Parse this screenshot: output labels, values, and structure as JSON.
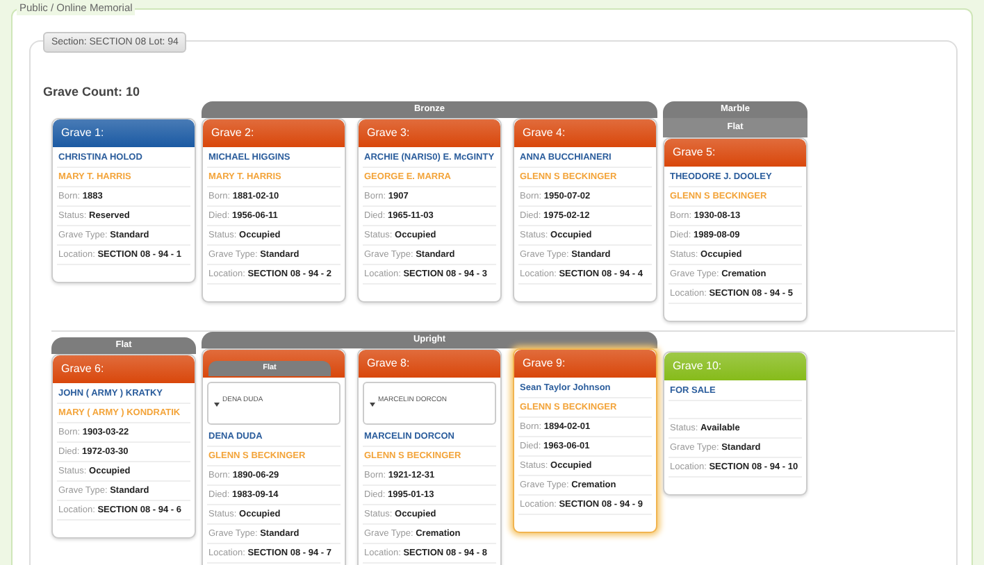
{
  "breadcrumb": "Public / Online Memorial",
  "section_legend": "Section: SECTION 08 Lot: 94",
  "grave_count": "Grave Count: 10",
  "rows": [
    {
      "groups": [
        {
          "graves": [
            {
              "title": "Grave 1:",
              "color": "#1b5aa3",
              "selected": false,
              "name": "CHRISTINA HOLOD",
              "owner": "MARY T. HARRIS",
              "fields": [
                {
                  "label": "Born:",
                  "value": "1883"
                },
                {
                  "label": "Status:",
                  "value": "Reserved"
                },
                {
                  "label": "Grave Type:",
                  "value": "Standard"
                },
                {
                  "label": "Location:",
                  "value": "SECTION 08 - 94 - 1"
                }
              ]
            }
          ]
        },
        {
          "labels": [
            "Bronze"
          ],
          "graves": [
            {
              "title": "Grave 2:",
              "color": "#d9470b",
              "selected": false,
              "name": "MICHAEL HIGGINS",
              "owner": "MARY T. HARRIS",
              "fields": [
                {
                  "label": "Born:",
                  "value": "1881-02-10"
                },
                {
                  "label": "Died:",
                  "value": "1956-06-11"
                },
                {
                  "label": "Status:",
                  "value": "Occupied"
                },
                {
                  "label": "Grave Type:",
                  "value": "Standard"
                },
                {
                  "label": "Location:",
                  "value": "SECTION 08 - 94 - 2"
                }
              ]
            },
            {
              "title": "Grave 3:",
              "color": "#d9470b",
              "selected": false,
              "name": "ARCHIE (NARIS0) E. McGINTY",
              "owner": "GEORGE E. MARRA",
              "fields": [
                {
                  "label": "Born:",
                  "value": "1907"
                },
                {
                  "label": "Died:",
                  "value": "1965-11-03"
                },
                {
                  "label": "Status:",
                  "value": "Occupied"
                },
                {
                  "label": "Grave Type:",
                  "value": "Standard"
                },
                {
                  "label": "Location:",
                  "value": "SECTION 08 - 94 - 3"
                }
              ]
            },
            {
              "title": "Grave 4:",
              "color": "#d9470b",
              "selected": false,
              "name": "ANNA BUCCHIANERI",
              "owner": "GLENN S BECKINGER",
              "fields": [
                {
                  "label": "Born:",
                  "value": "1950-07-02"
                },
                {
                  "label": "Died:",
                  "value": "1975-02-12"
                },
                {
                  "label": "Status:",
                  "value": "Occupied"
                },
                {
                  "label": "Grave Type:",
                  "value": "Standard"
                },
                {
                  "label": "Location:",
                  "value": "SECTION 08 - 94 - 4"
                }
              ]
            }
          ]
        },
        {
          "labels": [
            "Marble",
            "Flat"
          ],
          "graves": [
            {
              "title": "Grave 5:",
              "color": "#d9470b",
              "selected": false,
              "name": "THEODORE J. DOOLEY",
              "owner": "GLENN S BECKINGER",
              "fields": [
                {
                  "label": "Born:",
                  "value": "1930-08-13"
                },
                {
                  "label": "Died:",
                  "value": "1989-08-09"
                },
                {
                  "label": "Status:",
                  "value": "Occupied"
                },
                {
                  "label": "Grave Type:",
                  "value": "Cremation"
                },
                {
                  "label": "Location:",
                  "value": "SECTION 08 - 94 - 5"
                }
              ]
            }
          ]
        }
      ]
    },
    {
      "groups": [
        {
          "labels": [
            "Flat"
          ],
          "graves": [
            {
              "title": "Grave 6:",
              "color": "#d9470b",
              "selected": false,
              "name": "JOHN ( ARMY ) KRATKY",
              "owner": "MARY ( ARMY ) KONDRATIK",
              "fields": [
                {
                  "label": "Born:",
                  "value": "1903-03-22"
                },
                {
                  "label": "Died:",
                  "value": "1972-03-30"
                },
                {
                  "label": "Status:",
                  "value": "Occupied"
                },
                {
                  "label": "Grave Type:",
                  "value": "Standard"
                },
                {
                  "label": "Location:",
                  "value": "SECTION 08 - 94 - 6"
                }
              ]
            }
          ]
        },
        {
          "labels": [
            "Upright"
          ],
          "graves": [
            {
              "color": "#d9470b",
              "selected": false,
              "overlay_tab": "Flat",
              "dropdown": "DENA DUDA",
              "name": "DENA DUDA",
              "owner": "GLENN S BECKINGER",
              "fields": [
                {
                  "label": "Born:",
                  "value": "1890-06-29"
                },
                {
                  "label": "Died:",
                  "value": "1983-09-14"
                },
                {
                  "label": "Status:",
                  "value": "Occupied"
                },
                {
                  "label": "Grave Type:",
                  "value": "Standard"
                },
                {
                  "label": "Location:",
                  "value": "SECTION 08 - 94 - 7"
                }
              ]
            },
            {
              "title": "Grave 8:",
              "color": "#d9470b",
              "selected": false,
              "dropdown": "MARCELIN DORCON",
              "name": "MARCELIN DORCON",
              "owner": "GLENN S BECKINGER",
              "fields": [
                {
                  "label": "Born:",
                  "value": "1921-12-31"
                },
                {
                  "label": "Died:",
                  "value": "1995-01-13"
                },
                {
                  "label": "Status:",
                  "value": "Occupied"
                },
                {
                  "label": "Grave Type:",
                  "value": "Cremation"
                },
                {
                  "label": "Location:",
                  "value": "SECTION 08 - 94 - 8"
                }
              ]
            },
            {
              "title": "Grave 9:",
              "color": "#d9470b",
              "selected": true,
              "name": "Sean Taylor Johnson",
              "owner": "GLENN S BECKINGER",
              "fields": [
                {
                  "label": "Born:",
                  "value": "1894-02-01"
                },
                {
                  "label": "Died:",
                  "value": "1963-06-01"
                },
                {
                  "label": "Status:",
                  "value": "Occupied"
                },
                {
                  "label": "Grave Type:",
                  "value": "Cremation"
                },
                {
                  "label": "Location:",
                  "value": "SECTION 08 - 94 - 9"
                }
              ]
            }
          ]
        },
        {
          "graves": [
            {
              "title": "Grave 10:",
              "color": "#86bb1a",
              "selected": false,
              "name": "FOR SALE",
              "fields": [
                {
                  "label": "Status:",
                  "value": "Available"
                },
                {
                  "label": "Grave Type:",
                  "value": "Standard"
                },
                {
                  "label": "Location:",
                  "value": "SECTION 08 - 94 - 10"
                }
              ]
            }
          ]
        }
      ]
    }
  ]
}
